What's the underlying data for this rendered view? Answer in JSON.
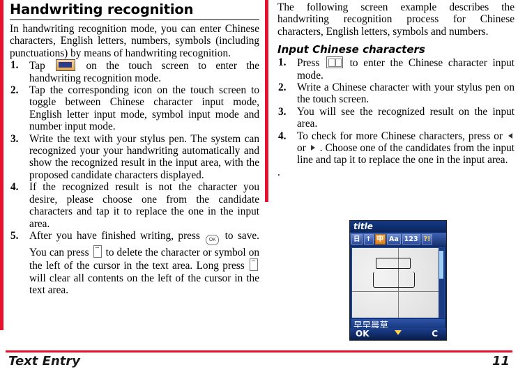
{
  "document": {
    "section_title": "Handwriting recognition",
    "footer_left": "Text Entry",
    "page_number": "11"
  },
  "left_column": {
    "intro": "In handwriting recognition mode, you can enter Chinese characters, English letters,  numbers, symbols (including punctuations) by means of handwriting recognition.",
    "steps": [
      {
        "num": "1.",
        "text_before_icon": "Tap",
        "icon": "handwriting-mode-icon",
        "text_after_icon": "on the touch screen to enter the handwriting recognition mode."
      },
      {
        "num": "2.",
        "text": "Tap the corresponding icon on the touch screen to toggle between Chinese character input mode, English letter input mode, symbol input mode and number input mode."
      },
      {
        "num": "3.",
        "text": "Write the text with your stylus pen. The system can recognized your your handwriting automatically and show the recognized result in the input area, with the proposed candidate characters displayed."
      },
      {
        "num": "4.",
        "text": "If the recognized result is not the character you desire, please choose one from the candidate characters and tap it to replace the one in the input area."
      },
      {
        "num": "5.",
        "part1": "After you have finished writing, press",
        "icon1": "ok-key-icon",
        "part2": "to save. You can press",
        "icon2": "clear-key-icon",
        "part3": "to delete the character or symbol on the left of the cursor in the text area.  Long press",
        "icon3": "clear-key-icon",
        "part4": "will clear all contents on the left of the cursor in the text area."
      }
    ]
  },
  "right_column": {
    "intro": "The following screen example describes the handwriting recognition process for Chinese characters, English letters, symbols and numbers.",
    "sub_title": "Input Chinese characters",
    "steps": [
      {
        "num": "1.",
        "text_before_icon": "Press",
        "icon": "chinese-input-icon",
        "text_after_icon": "to enter the Chinese character input mode."
      },
      {
        "num": "2.",
        "text": "Write a Chinese character with your stylus pen on the touch screen."
      },
      {
        "num": "3.",
        "text": "You will see the recognized result on the input area."
      },
      {
        "num": "4.",
        "part1": "To check for more Chinese characters, press or",
        "icon_left": "left-arrow-icon",
        "mid": "or",
        "icon_right": "right-arrow-icon",
        "part2": ". Choose one of the candidates from the input line and tap it to replace the one in the input area."
      }
    ],
    "trailing_dot": "."
  },
  "phone_figure": {
    "title": "title",
    "toolbar": [
      {
        "label": "日",
        "highlight": false
      },
      {
        "label": "↑",
        "highlight": false
      },
      {
        "label": "中",
        "highlight": true
      },
      {
        "label": "Aa",
        "highlight": false
      },
      {
        "label": "123",
        "highlight": false
      },
      {
        "label": "?!",
        "highlight": false
      }
    ],
    "candidate_line": "早早晨草",
    "softkey_left": "OK",
    "softkey_right": "C"
  },
  "colors": {
    "accent_red": "#e8112d",
    "phone_blue": "#0b2d6b",
    "highlight_orange": "#d87f1b"
  }
}
